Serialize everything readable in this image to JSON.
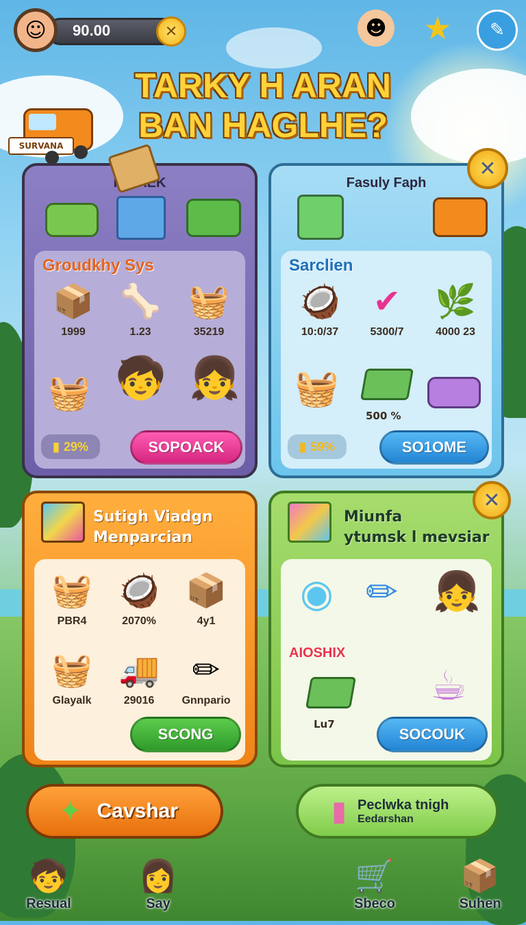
{
  "hud": {
    "coins": "90.00",
    "close_glyph": "✕",
    "avatar_icon": "girl-avatar-icon",
    "star_icon": "star-icon",
    "chat_icon": "chat-bubble-icon"
  },
  "title": {
    "line1": "TARKY H ARAN",
    "line2": "BAN HAGLHE?"
  },
  "truck_sign": "SURVANA",
  "panel_purple": {
    "title": "HIRAEK",
    "section_label": "Groudkhy Sys",
    "items": [
      {
        "label": "1999",
        "icon": "crate-icon"
      },
      {
        "label": "1.23",
        "icon": "bone-icon"
      },
      {
        "label": "35219",
        "icon": "basket-icon"
      }
    ],
    "badge": "29%",
    "button": "SOPOACK"
  },
  "panel_blue": {
    "title": "Fasuly Faph",
    "section_label": "Sarclien",
    "items": [
      {
        "label": "10:0/37",
        "icon": "coconut-icon"
      },
      {
        "label": "5300/7",
        "icon": "check-badge-icon"
      },
      {
        "label": "4000 23",
        "icon": "plant-crate-icon"
      }
    ],
    "extra_label": "500 %",
    "badge": "59%",
    "button": "SO1OME"
  },
  "panel_orange": {
    "title_line1": "Sutigh Viadgn",
    "title_line2": "Menparcian",
    "items": [
      {
        "label": "PBR4",
        "icon": "basket-icon"
      },
      {
        "label": "2070%",
        "icon": "coconut-icon"
      },
      {
        "label": "4y1",
        "icon": "box-icon"
      },
      {
        "label": "Glayalk",
        "icon": "coin-basket-icon"
      },
      {
        "label": "29016",
        "icon": "truck-icon"
      },
      {
        "label": "Gnnpario",
        "icon": "pencil-icon"
      }
    ],
    "button": "SCONG"
  },
  "panel_green": {
    "title_line1": "Miunfa",
    "title_line2": "ytumsk l mevsiar",
    "section_label": "AIOSHIX",
    "item_label": "Lu7",
    "button": "SOCOUK"
  },
  "bottom": {
    "left_button": "Cavshar",
    "right_line1": "Peclwka tnigh",
    "right_line2": "Eedarshan"
  },
  "nav": [
    {
      "label": "Resual",
      "icon": "boy-avatar-icon"
    },
    {
      "label": "Say",
      "icon": "girl-avatar-icon"
    },
    {
      "label": "Sbeco",
      "icon": "cart-icon"
    },
    {
      "label": "Suhen",
      "icon": "dollar-box-icon"
    }
  ],
  "colors": {
    "purple_panel": "#7a6bb0",
    "blue_panel": "#6cc4ec",
    "orange_panel": "#f39a2c",
    "green_panel": "#8fcf55",
    "pink_button": "#e83c98",
    "blue_button": "#2f9ae0",
    "green_button": "#45b43a"
  }
}
